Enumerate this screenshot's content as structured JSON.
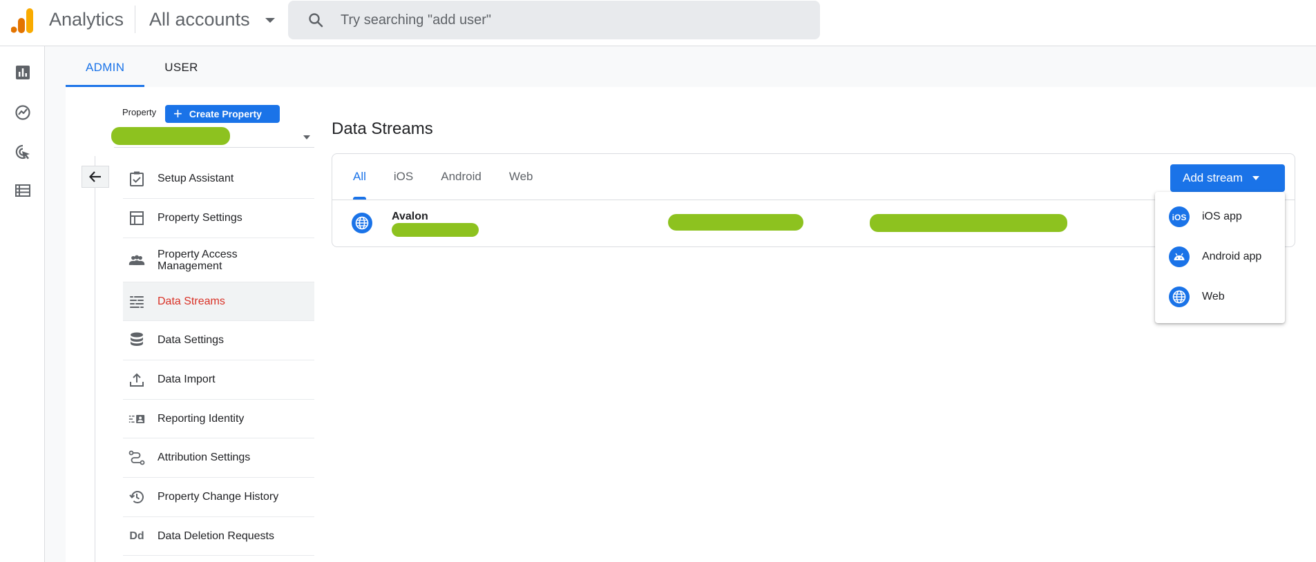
{
  "header": {
    "app_title": "Analytics",
    "account_selector": "All accounts",
    "search_placeholder": "Try searching \"add user\""
  },
  "left_nav": {
    "icons": [
      "reports-icon",
      "explore-icon",
      "advertising-icon",
      "configure-icon"
    ]
  },
  "admin_tabs": [
    {
      "label": "ADMIN",
      "active": true
    },
    {
      "label": "USER",
      "active": false
    }
  ],
  "property": {
    "label": "Property",
    "create_button": "Create Property"
  },
  "menu": {
    "items": [
      {
        "label": "Setup Assistant",
        "icon": "checklist-icon"
      },
      {
        "label": "Property Settings",
        "icon": "layout-icon"
      },
      {
        "label": "Property Access Management",
        "icon": "people-icon"
      },
      {
        "label": "Data Streams",
        "icon": "streams-icon",
        "active": true
      },
      {
        "label": "Data Settings",
        "icon": "database-icon"
      },
      {
        "label": "Data Import",
        "icon": "upload-icon"
      },
      {
        "label": "Reporting Identity",
        "icon": "identity-icon"
      },
      {
        "label": "Attribution Settings",
        "icon": "attribution-icon"
      },
      {
        "label": "Property Change History",
        "icon": "history-icon"
      },
      {
        "label": "Data Deletion Requests",
        "icon": "dd-icon",
        "icon_text": "Dd"
      }
    ]
  },
  "main": {
    "title": "Data Streams",
    "stream_tabs": [
      {
        "label": "All",
        "active": true
      },
      {
        "label": "iOS",
        "active": false
      },
      {
        "label": "Android",
        "active": false
      },
      {
        "label": "Web",
        "active": false
      }
    ],
    "add_stream_button": "Add stream",
    "streams": [
      {
        "name": "Avalon",
        "type": "web"
      }
    ]
  },
  "add_stream_menu": {
    "items": [
      {
        "label": "iOS app",
        "icon": "ios-icon",
        "icon_text": "iOS"
      },
      {
        "label": "Android app",
        "icon": "android-icon"
      },
      {
        "label": "Web",
        "icon": "globe-icon"
      }
    ]
  },
  "colors": {
    "accent": "#1a73e8",
    "active_menu_text": "#d93025",
    "redaction": "#8dc21f",
    "logo_orange": "#f9ab00",
    "logo_dark_orange": "#e37400"
  }
}
